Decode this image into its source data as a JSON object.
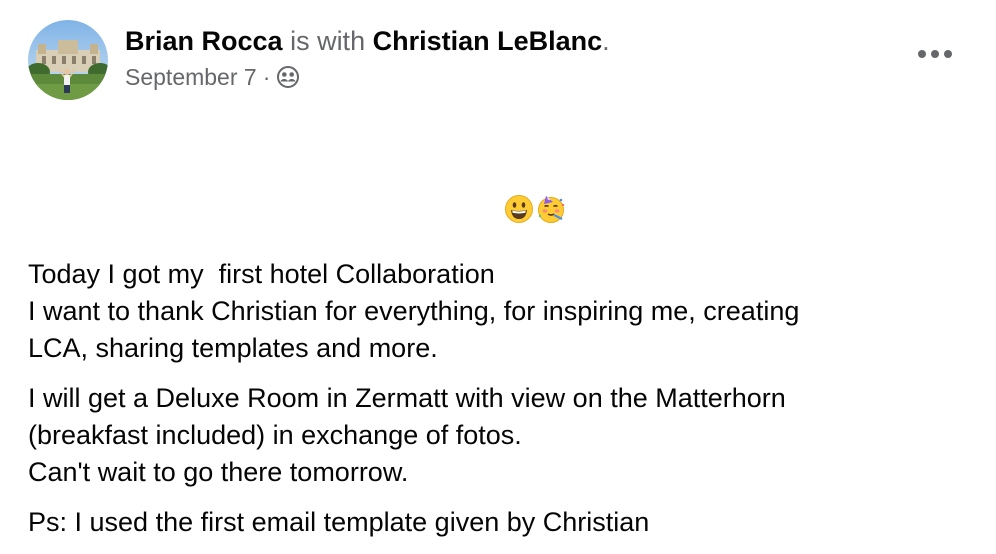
{
  "post": {
    "author": "Brian Rocca",
    "connector": " is with ",
    "tagged": "Christian LeBlanc",
    "end_punct": ".",
    "date": "September 7",
    "separator": "·",
    "privacy_icon": "friends-icon",
    "more_icon": "more-options-icon",
    "paragraphs": [
      {
        "lines": [
          "Today I got my  first hotel Collaboration ",
          "I want to thank Christian for everything, for inspiring me, creating",
          "LCA, sharing templates and more."
        ],
        "emojis": [
          "grinning-face-emoji",
          "partying-face-emoji"
        ]
      },
      {
        "lines": [
          "I will get a Deluxe Room in Zermatt with view on the Matterhorn",
          "(breakfast included) in exchange of fotos.",
          "Can't wait to go there tomorrow."
        ]
      },
      {
        "lines": [
          "Ps: I used the first email template given by Christian"
        ]
      }
    ]
  },
  "colors": {
    "text_primary": "#050505",
    "text_secondary": "#65676b",
    "background": "#ffffff"
  }
}
